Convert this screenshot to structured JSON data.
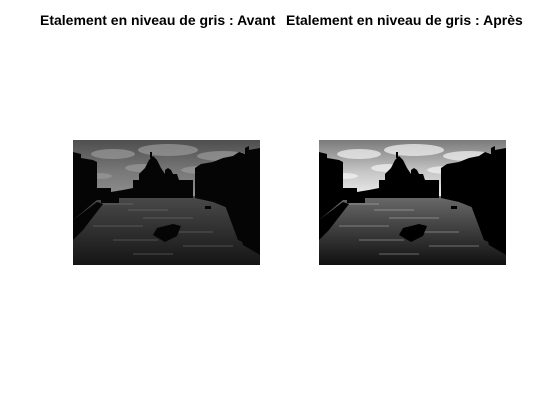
{
  "figure": {
    "subplots": [
      {
        "title": "Etalement en niveau de gris : Avant",
        "image": {
          "kind": "grayscale photo (Venice Grand Canal at dusk)",
          "sky_top": "#4e4e4e",
          "sky_mid": "#777777",
          "sky_horizon": "#8f8f8f",
          "cloud": "#9a9a9a",
          "water_top": "#4a4a4a",
          "water_bottom": "#151515",
          "silhouette": "#050505",
          "glint": "#8a8a8a"
        }
      },
      {
        "title": "Etalement en niveau de gris : Après",
        "image": {
          "kind": "grayscale photo (Venice Grand Canal at dusk), contrast stretched",
          "sky_top": "#7a7a7a",
          "sky_mid": "#c4c4c4",
          "sky_horizon": "#ececec",
          "cloud": "#f4f4f4",
          "water_top": "#6a6a6a",
          "water_bottom": "#101010",
          "silhouette": "#000000",
          "glint": "#d8d8d8"
        }
      }
    ]
  }
}
